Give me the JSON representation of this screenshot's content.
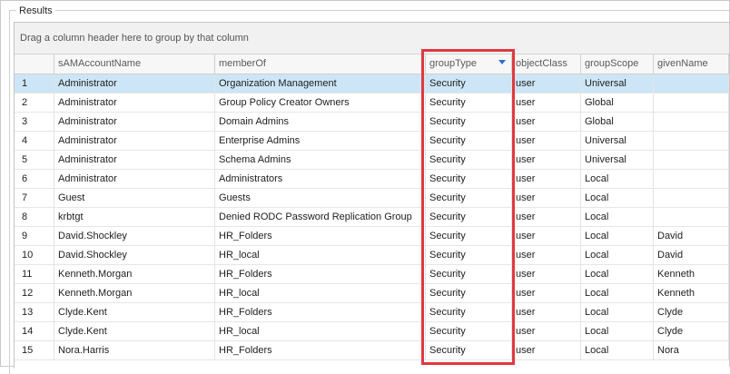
{
  "results_label": "Results",
  "group_panel_text": "Drag a column header here to group by that column",
  "columns": [
    "",
    "sAMAccountName",
    "memberOf",
    "groupType",
    "objectClass",
    "groupScope",
    "givenName"
  ],
  "rows": [
    {
      "n": "1",
      "sam": "Administrator",
      "member": "Organization Management",
      "gtype": "Security",
      "oclass": "user",
      "scope": "Universal",
      "given": ""
    },
    {
      "n": "2",
      "sam": "Administrator",
      "member": "Group Policy Creator Owners",
      "gtype": "Security",
      "oclass": "user",
      "scope": "Global",
      "given": ""
    },
    {
      "n": "3",
      "sam": "Administrator",
      "member": "Domain Admins",
      "gtype": "Security",
      "oclass": "user",
      "scope": "Global",
      "given": ""
    },
    {
      "n": "4",
      "sam": "Administrator",
      "member": "Enterprise Admins",
      "gtype": "Security",
      "oclass": "user",
      "scope": "Universal",
      "given": ""
    },
    {
      "n": "5",
      "sam": "Administrator",
      "member": "Schema Admins",
      "gtype": "Security",
      "oclass": "user",
      "scope": "Universal",
      "given": ""
    },
    {
      "n": "6",
      "sam": "Administrator",
      "member": "Administrators",
      "gtype": "Security",
      "oclass": "user",
      "scope": "Local",
      "given": ""
    },
    {
      "n": "7",
      "sam": "Guest",
      "member": "Guests",
      "gtype": "Security",
      "oclass": "user",
      "scope": "Local",
      "given": ""
    },
    {
      "n": "8",
      "sam": "krbtgt",
      "member": "Denied RODC Password Replication Group",
      "gtype": "Security",
      "oclass": "user",
      "scope": "Local",
      "given": ""
    },
    {
      "n": "9",
      "sam": "David.Shockley",
      "member": "HR_Folders",
      "gtype": "Security",
      "oclass": "user",
      "scope": "Local",
      "given": "David"
    },
    {
      "n": "10",
      "sam": "David.Shockley",
      "member": "HR_local",
      "gtype": "Security",
      "oclass": "user",
      "scope": "Local",
      "given": "David"
    },
    {
      "n": "11",
      "sam": "Kenneth.Morgan",
      "member": "HR_Folders",
      "gtype": "Security",
      "oclass": "user",
      "scope": "Local",
      "given": "Kenneth"
    },
    {
      "n": "12",
      "sam": "Kenneth.Morgan",
      "member": "HR_local",
      "gtype": "Security",
      "oclass": "user",
      "scope": "Local",
      "given": "Kenneth"
    },
    {
      "n": "13",
      "sam": "Clyde.Kent",
      "member": "HR_Folders",
      "gtype": "Security",
      "oclass": "user",
      "scope": "Local",
      "given": "Clyde"
    },
    {
      "n": "14",
      "sam": "Clyde.Kent",
      "member": "HR_local",
      "gtype": "Security",
      "oclass": "user",
      "scope": "Local",
      "given": "Clyde"
    },
    {
      "n": "15",
      "sam": "Nora.Harris",
      "member": "HR_Folders",
      "gtype": "Security",
      "oclass": "user",
      "scope": "Local",
      "given": "Nora"
    }
  ],
  "selected_row": "1",
  "filter_icon": "filter-icon",
  "highlight_color": "#e0393e",
  "selection_color": "#cde6f7"
}
